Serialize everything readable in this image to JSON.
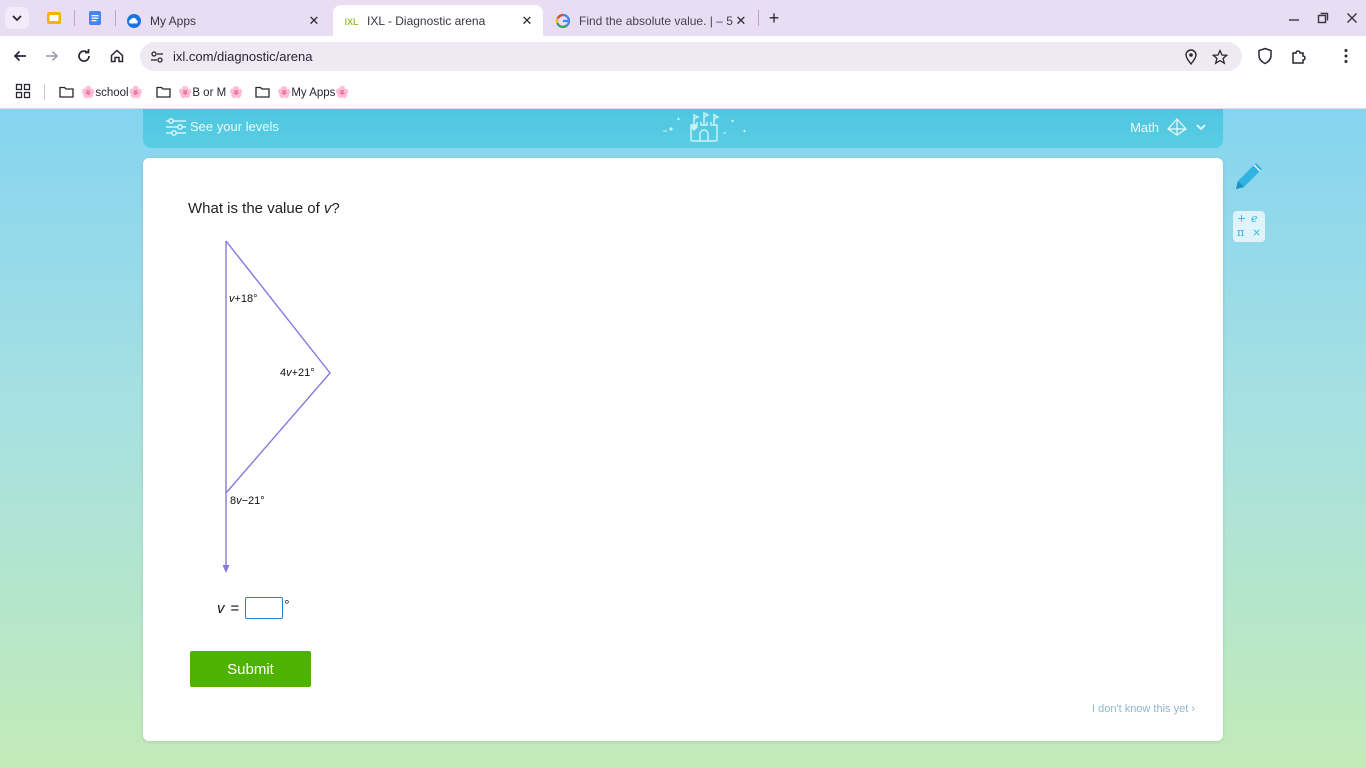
{
  "browser": {
    "tabs": [
      {
        "title": "My Apps",
        "favicon": "cloud-icon",
        "active": false
      },
      {
        "title": "IXL - Diagnostic arena",
        "favicon": "ixl-icon",
        "active": true
      },
      {
        "title": "Find the absolute value. | – 5+",
        "favicon": "google-icon",
        "active": false
      }
    ],
    "pinned_tabs": [
      "slides-icon",
      "docs-icon"
    ],
    "url": "ixl.com/diagnostic/arena",
    "bookmarks": [
      {
        "label": "🌸school🌸"
      },
      {
        "label": "🌸B or M 🌸"
      },
      {
        "label": "🌸My Apps🌸"
      }
    ]
  },
  "header": {
    "levels_label": "See your levels",
    "subject": "Math"
  },
  "question": {
    "prefix": "What is the value of ",
    "variable": "v",
    "suffix": "?"
  },
  "diagram": {
    "angles": [
      {
        "var": "v",
        "expr": "+18°"
      },
      {
        "coef": "4",
        "var": "v",
        "expr": "+21°"
      },
      {
        "coef": "8",
        "var": "v",
        "expr": "−21°"
      }
    ]
  },
  "answer": {
    "variable": "v",
    "equals": "=",
    "value": "",
    "unit": "°"
  },
  "submit_label": "Submit",
  "dont_know_label": "I don't know this yet ›",
  "tools": {
    "calculator_symbols": [
      "+",
      "e",
      "π",
      "×"
    ]
  },
  "colors": {
    "accent_blue": "#4fc6e0",
    "submit_green": "#4db300",
    "diagram_stroke": "#8878e0"
  }
}
